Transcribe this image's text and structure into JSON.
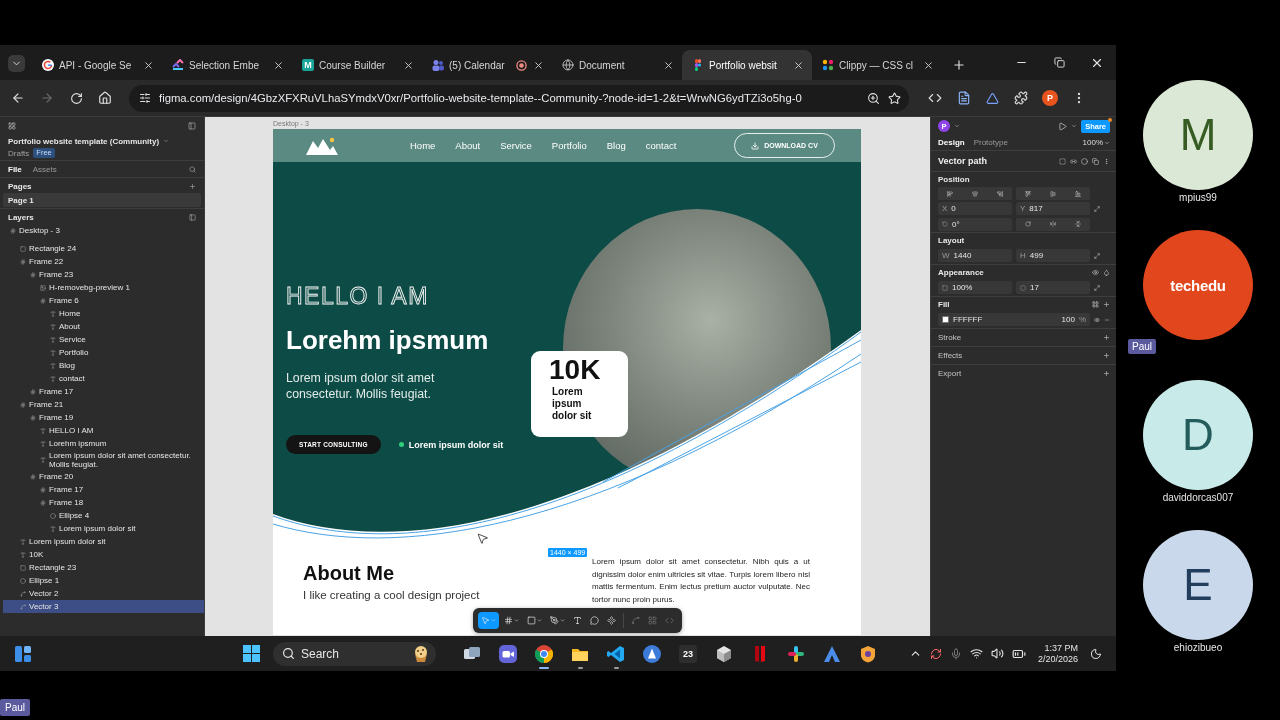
{
  "browser": {
    "tabs": [
      {
        "title": "API - Google Se",
        "selected": false,
        "recording": false
      },
      {
        "title": "Selection Embe",
        "selected": false,
        "recording": false
      },
      {
        "title": "Course Builder",
        "icon_text": "M",
        "selected": false,
        "recording": false
      },
      {
        "title": "(5) Calendar",
        "selected": false,
        "recording": true
      },
      {
        "title": "Document",
        "selected": false,
        "recording": false
      },
      {
        "title": "Portfolio websit",
        "selected": true,
        "recording": false
      },
      {
        "title": "Clippy — CSS cl",
        "selected": false,
        "recording": false
      }
    ],
    "forward_disabled": true,
    "url": "figma.com/design/4GbzXFXRuVLhaSYmdxV0xr/Portfolio-website-template--Community-?node-id=1-2&t=WrwNG6ydTZi3o5hg-0",
    "profile_initial": "P"
  },
  "figma": {
    "file_title": "Portfolio website template (Community)",
    "location": "Drafts",
    "plan": "Free",
    "panel_tabs": [
      {
        "label": "File",
        "selected": true
      },
      {
        "label": "Assets",
        "selected": false
      }
    ],
    "pages_heading": "Pages",
    "pages": [
      {
        "name": "Page 1",
        "selected": true
      }
    ],
    "layers_heading": "Layers",
    "layers": [
      {
        "name": "Desktop - 3",
        "kind": "frame",
        "selected": false,
        "children": [
          {
            "name": "Rectangle 24",
            "kind": "rect",
            "selected": false
          },
          {
            "name": "Frame 22",
            "kind": "frame",
            "selected": false,
            "children": [
              {
                "name": "Frame 23",
                "kind": "frame",
                "selected": false,
                "children": [
                  {
                    "name": "H-removebg-preview 1",
                    "kind": "image",
                    "selected": false
                  },
                  {
                    "name": "Frame 6",
                    "kind": "frame",
                    "selected": false,
                    "children": [
                      {
                        "name": "Home",
                        "kind": "text",
                        "selected": false
                      },
                      {
                        "name": "About",
                        "kind": "text",
                        "selected": false
                      },
                      {
                        "name": "Service",
                        "kind": "text",
                        "selected": false
                      },
                      {
                        "name": "Portfolio",
                        "kind": "text",
                        "selected": false
                      },
                      {
                        "name": "Blog",
                        "kind": "text",
                        "selected": false
                      },
                      {
                        "name": "contact",
                        "kind": "text",
                        "selected": false
                      }
                    ]
                  }
                ]
              },
              {
                "name": "Frame 17",
                "kind": "frame",
                "selected": false
              }
            ]
          },
          {
            "name": "Frame 21",
            "kind": "frame",
            "selected": false,
            "children": [
              {
                "name": "Frame 19",
                "kind": "frame",
                "selected": false,
                "children": [
                  {
                    "name": "HELLO I AM",
                    "kind": "text",
                    "selected": false
                  },
                  {
                    "name": "Lorehm ipsmum",
                    "kind": "text",
                    "selected": false
                  },
                  {
                    "name": "Lorem ipsum dolor sit amet consectetur. Mollis feugiat.",
                    "kind": "text",
                    "selected": false
                  }
                ]
              },
              {
                "name": "Frame 20",
                "kind": "frame",
                "selected": false,
                "children": [
                  {
                    "name": "Frame 17",
                    "kind": "frame",
                    "selected": false
                  },
                  {
                    "name": "Frame 18",
                    "kind": "frame",
                    "selected": false,
                    "children": [
                      {
                        "name": "Ellipse 4",
                        "kind": "ellipse",
                        "selected": false
                      },
                      {
                        "name": "Lorem ipsum dolor sit",
                        "kind": "text",
                        "selected": false
                      }
                    ]
                  }
                ]
              }
            ]
          },
          {
            "name": "Lorem ipsum dolor sit",
            "kind": "text",
            "selected": false
          },
          {
            "name": "10K",
            "kind": "text",
            "selected": false
          },
          {
            "name": "Rectangle 23",
            "kind": "rect",
            "selected": false
          },
          {
            "name": "Ellipse 1",
            "kind": "ellipse",
            "selected": false
          },
          {
            "name": "Vector 2",
            "kind": "vector",
            "selected": false
          },
          {
            "name": "Vector 3",
            "kind": "vector",
            "selected": true
          }
        ]
      }
    ]
  },
  "canvas": {
    "frame_label": "Desktop - 3",
    "selection_size": "1440 × 499",
    "design": {
      "nav_items": [
        "Home",
        "About",
        "Service",
        "Portfolio",
        "Blog",
        "contact"
      ],
      "download_button": "DOWNLOAD CV",
      "greeting": "HELLO I AM",
      "name": "Lorehm ipsmum",
      "intro": "Lorem ipsum dolor sit amet consectetur. Mollis feugiat.",
      "cta": "START CONSULTING",
      "status_text": "Lorem ipsum dolor sit",
      "stat_value": "10K",
      "stat_label": "Lorem ipsum dolor sit",
      "about_heading": "About Me",
      "about_subtitle": "I like creating a cool design project",
      "about_text": "Lorem ipsum dolor sit amet consectetur. Nibh quis a ut dignissim dolor enim ultricies sit vitae. Turpis lorem libero nisl mattis fermentum. Enim lectus pretium auctor vulputate. Nec tortor nunc proin purus."
    },
    "tools": [
      {
        "selected": true,
        "has_menu": true
      },
      {
        "selected": false,
        "has_menu": true
      },
      {
        "selected": false,
        "has_menu": true
      },
      {
        "selected": false,
        "has_menu": true
      },
      {
        "selected": false,
        "has_menu": false
      },
      {
        "selected": false,
        "has_menu": false
      },
      {
        "selected": false,
        "has_menu": false
      },
      {
        "selected": false,
        "has_menu": false
      },
      {
        "selected": false,
        "has_menu": false
      },
      {
        "selected": false,
        "has_menu": false
      }
    ]
  },
  "properties": {
    "avatar_initial": "P",
    "share_label": "Share",
    "share_notification": true,
    "tabs": [
      {
        "label": "Design",
        "selected": true
      },
      {
        "label": "Prototype",
        "selected": false
      }
    ],
    "zoom": "100%",
    "selection_type": "Vector path",
    "position": {
      "heading": "Position",
      "x": {
        "label": "X",
        "value": "0"
      },
      "y": {
        "label": "Y",
        "value": "817"
      },
      "rotation": "0°"
    },
    "layout": {
      "heading": "Layout",
      "width": {
        "label": "W",
        "value": "1440"
      },
      "height": {
        "label": "H",
        "value": "499"
      }
    },
    "appearance": {
      "heading": "Appearance",
      "opacity": "100%",
      "radius": "17"
    },
    "fill": {
      "heading": "Fill",
      "hex": "FFFFFF",
      "opacity": "100",
      "unit": "%"
    },
    "more_sections": [
      "Stroke",
      "Effects",
      "Export"
    ]
  },
  "taskbar": {
    "search_placeholder": "Search",
    "apps": [
      {
        "kind": "taskview",
        "running": false,
        "focused": false
      },
      {
        "kind": "meet",
        "running": false,
        "focused": false
      },
      {
        "kind": "chrome",
        "running": true,
        "focused": true
      },
      {
        "kind": "explorer",
        "running": true,
        "focused": false
      },
      {
        "kind": "vscode",
        "running": true,
        "focused": false
      },
      {
        "kind": "compass",
        "running": false,
        "focused": false
      },
      {
        "kind": "day",
        "text": "23",
        "running": false,
        "focused": false
      },
      {
        "kind": "cube",
        "running": false,
        "focused": false
      },
      {
        "kind": "ribbon",
        "running": false,
        "focused": false
      },
      {
        "kind": "pinwheel",
        "running": false,
        "focused": false
      },
      {
        "kind": "peak",
        "running": false,
        "focused": false
      },
      {
        "kind": "shield",
        "running": false,
        "focused": false
      }
    ],
    "time": "1:37 PM",
    "date": "2/20/2026"
  },
  "participants": [
    {
      "kind": "initial",
      "initial": "M",
      "name": "mpius99",
      "color": "#dce8d6"
    },
    {
      "kind": "logo",
      "logo_text": "techedu",
      "name": "Paul",
      "color": "#e2461d"
    },
    {
      "kind": "initial",
      "initial": "D",
      "name": "daviddorcas007",
      "color": "#c8ebe9"
    },
    {
      "kind": "initial",
      "initial": "E",
      "name": "ehiozibueo",
      "color": "#c9d8ea"
    }
  ],
  "presenter_label": "Paul"
}
